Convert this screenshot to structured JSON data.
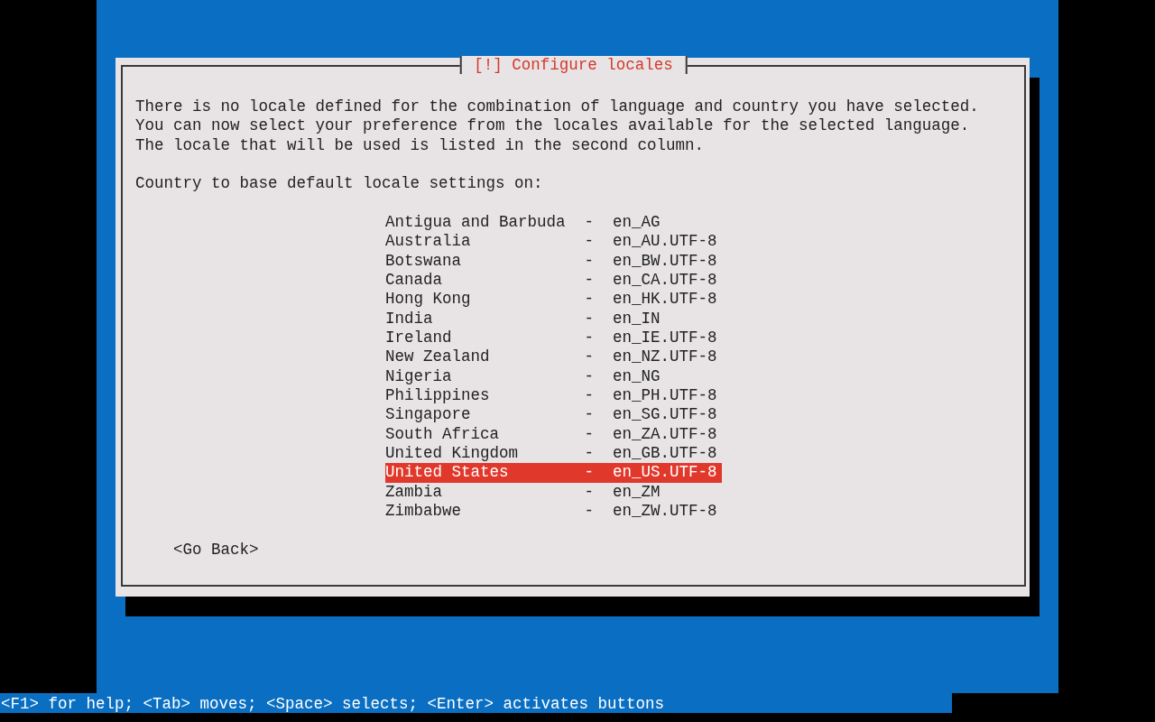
{
  "dialog": {
    "title": "[!] Configure locales",
    "message": [
      "There is no locale defined for the combination of language and country you have selected.",
      "You can now select your preference from the locales available for the selected language.",
      "The locale that will be used is listed in the second column."
    ],
    "prompt": "Country to base default locale settings on:",
    "options": [
      {
        "country": "Antigua and Barbuda",
        "separator": "-",
        "locale": "en_AG",
        "selected": false
      },
      {
        "country": "Australia",
        "separator": "-",
        "locale": "en_AU.UTF-8",
        "selected": false
      },
      {
        "country": "Botswana",
        "separator": "-",
        "locale": "en_BW.UTF-8",
        "selected": false
      },
      {
        "country": "Canada",
        "separator": "-",
        "locale": "en_CA.UTF-8",
        "selected": false
      },
      {
        "country": "Hong Kong",
        "separator": "-",
        "locale": "en_HK.UTF-8",
        "selected": false
      },
      {
        "country": "India",
        "separator": "-",
        "locale": "en_IN",
        "selected": false
      },
      {
        "country": "Ireland",
        "separator": "-",
        "locale": "en_IE.UTF-8",
        "selected": false
      },
      {
        "country": "New Zealand",
        "separator": "-",
        "locale": "en_NZ.UTF-8",
        "selected": false
      },
      {
        "country": "Nigeria",
        "separator": "-",
        "locale": "en_NG",
        "selected": false
      },
      {
        "country": "Philippines",
        "separator": "-",
        "locale": "en_PH.UTF-8",
        "selected": false
      },
      {
        "country": "Singapore",
        "separator": "-",
        "locale": "en_SG.UTF-8",
        "selected": false
      },
      {
        "country": "South Africa",
        "separator": "-",
        "locale": "en_ZA.UTF-8",
        "selected": false
      },
      {
        "country": "United Kingdom",
        "separator": "-",
        "locale": "en_GB.UTF-8",
        "selected": false
      },
      {
        "country": "United States",
        "separator": "-",
        "locale": "en_US.UTF-8",
        "selected": true
      },
      {
        "country": "Zambia",
        "separator": "-",
        "locale": "en_ZM",
        "selected": false
      },
      {
        "country": "Zimbabwe",
        "separator": "-",
        "locale": "en_ZW.UTF-8",
        "selected": false
      }
    ],
    "buttons": [
      "<Go Back>"
    ]
  },
  "status_bar": "<F1> for help; <Tab> moves; <Space> selects; <Enter> activates buttons"
}
